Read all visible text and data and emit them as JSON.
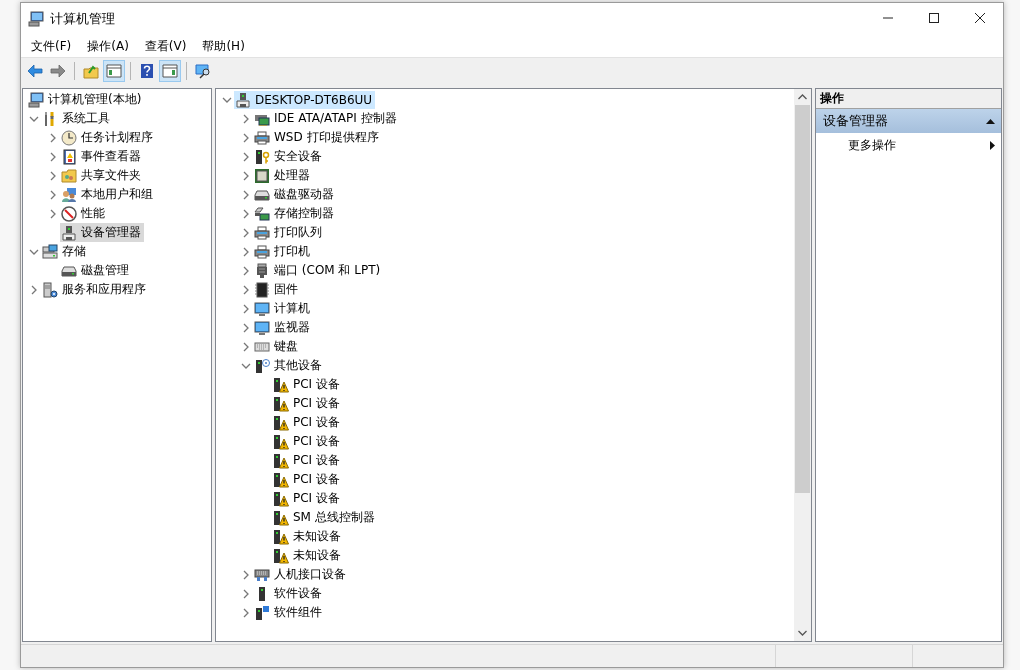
{
  "window": {
    "title": "计算机管理"
  },
  "menu": [
    {
      "label": "文件(F)"
    },
    {
      "label": "操作(A)"
    },
    {
      "label": "查看(V)"
    },
    {
      "label": "帮助(H)"
    }
  ],
  "toolbar": [
    {
      "kind": "back",
      "disabled": false,
      "pressed": false
    },
    {
      "kind": "forward",
      "disabled": true,
      "pressed": false
    },
    {
      "kind": "separator"
    },
    {
      "kind": "up",
      "pressed": false
    },
    {
      "kind": "console-tree",
      "pressed": true
    },
    {
      "kind": "separator"
    },
    {
      "kind": "help",
      "pressed": false
    },
    {
      "kind": "action-pane",
      "pressed": true
    },
    {
      "kind": "separator"
    },
    {
      "kind": "monitor-search",
      "pressed": false
    }
  ],
  "console_tree": {
    "root": {
      "label": "计算机管理(本地)",
      "kind": "computer",
      "selected": false,
      "children": [
        {
          "label": "系统工具",
          "kind": "tools",
          "expanded": true,
          "selected": false,
          "children": [
            {
              "label": "任务计划程序",
              "kind": "clock",
              "expanded": false,
              "selected": false
            },
            {
              "label": "事件查看器",
              "kind": "log",
              "expanded": false,
              "selected": false
            },
            {
              "label": "共享文件夹",
              "kind": "shared-folder",
              "expanded": false,
              "selected": false
            },
            {
              "label": "本地用户和组",
              "kind": "users",
              "expanded": false,
              "selected": false
            },
            {
              "label": "性能",
              "kind": "gauge",
              "expanded": false,
              "selected": false
            },
            {
              "label": "设备管理器",
              "kind": "device",
              "selected": true
            }
          ]
        },
        {
          "label": "存储",
          "kind": "storage",
          "expanded": true,
          "selected": false,
          "children": [
            {
              "label": "磁盘管理",
              "kind": "drive",
              "selected": false
            }
          ]
        },
        {
          "label": "服务和应用程序",
          "kind": "services",
          "expanded": false,
          "selected": false
        }
      ]
    }
  },
  "device_tree": {
    "items": [
      {
        "label": "DESKTOP-DT6B6UU",
        "kind": "device",
        "expanded": true,
        "selected": true,
        "children": [
          {
            "label": "IDE ATA/ATAPI 控制器",
            "kind": "card",
            "expanded": false,
            "selected": false
          },
          {
            "label": "WSD 打印提供程序",
            "kind": "printer",
            "expanded": false,
            "selected": false
          },
          {
            "label": "安全设备",
            "kind": "security",
            "expanded": false,
            "selected": false
          },
          {
            "label": "处理器",
            "kind": "cpu",
            "expanded": false,
            "selected": false
          },
          {
            "label": "磁盘驱动器",
            "kind": "drive",
            "expanded": false,
            "selected": false
          },
          {
            "label": "存储控制器",
            "kind": "storage-controller",
            "expanded": false,
            "selected": false
          },
          {
            "label": "打印队列",
            "kind": "printer",
            "expanded": false,
            "selected": false
          },
          {
            "label": "打印机",
            "kind": "printer",
            "expanded": false,
            "selected": false
          },
          {
            "label": "端口 (COM 和 LPT)",
            "kind": "port",
            "expanded": false,
            "selected": false
          },
          {
            "label": "固件",
            "kind": "chip",
            "expanded": false,
            "selected": false
          },
          {
            "label": "计算机",
            "kind": "monitor",
            "expanded": false,
            "selected": false
          },
          {
            "label": "监视器",
            "kind": "monitor",
            "expanded": false,
            "selected": false
          },
          {
            "label": "键盘",
            "kind": "keyboard",
            "expanded": false,
            "selected": false
          },
          {
            "label": "其他设备",
            "kind": "unknown",
            "expanded": true,
            "selected": false,
            "children": [
              {
                "label": "PCI 设备",
                "kind": "warning-device",
                "selected": false
              },
              {
                "label": "PCI 设备",
                "kind": "warning-device",
                "selected": false
              },
              {
                "label": "PCI 设备",
                "kind": "warning-device",
                "selected": false
              },
              {
                "label": "PCI 设备",
                "kind": "warning-device",
                "selected": false
              },
              {
                "label": "PCI 设备",
                "kind": "warning-device",
                "selected": false
              },
              {
                "label": "PCI 设备",
                "kind": "warning-device",
                "selected": false
              },
              {
                "label": "PCI 设备",
                "kind": "warning-device",
                "selected": false
              },
              {
                "label": "SM 总线控制器",
                "kind": "warning-device",
                "selected": false
              },
              {
                "label": "未知设备",
                "kind": "warning-device",
                "selected": false
              },
              {
                "label": "未知设备",
                "kind": "warning-device",
                "selected": false
              }
            ]
          },
          {
            "label": "人机接口设备",
            "kind": "hid",
            "expanded": false,
            "selected": false
          },
          {
            "label": "软件设备",
            "kind": "software-device",
            "expanded": false,
            "selected": false
          },
          {
            "label": "软件组件",
            "kind": "software-component",
            "expanded": false,
            "selected": false
          }
        ]
      }
    ]
  },
  "actions": {
    "title": "操作",
    "sections": [
      {
        "title": "设备管理器",
        "expanded": true,
        "items": [
          {
            "label": "更多操作",
            "submenu": true
          }
        ]
      }
    ]
  }
}
